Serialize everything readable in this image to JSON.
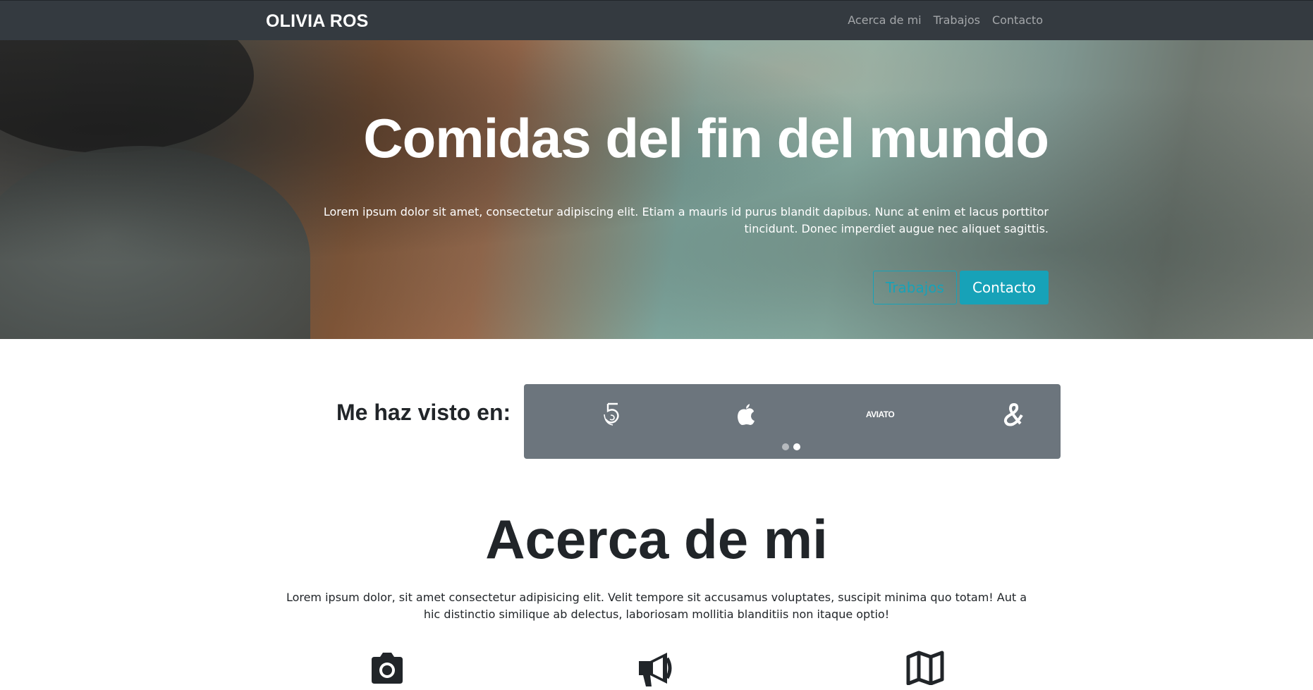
{
  "navbar": {
    "brand": "OLIVIA ROS",
    "links": [
      "Acerca de mi",
      "Trabajos",
      "Contacto"
    ]
  },
  "hero": {
    "title": "Comidas del fin del mundo",
    "lead": "Lorem ipsum dolor sit amet, consectetur adipiscing elit. Etiam a mauris id purus blandit dapibus. Nunc at enim et lacus porttitor tincidunt. Donec imperdiet augue nec aliquet sagittis.",
    "buttons": [
      "Trabajos",
      "Contacto"
    ]
  },
  "seen_on": {
    "label": "Me haz visto en:",
    "logos": [
      "five-logo-icon",
      "apple-logo-icon",
      "aviato-logo-icon",
      "ampersand-logo-icon"
    ],
    "aviato_text": "AVIATO",
    "carousel_slide": 2,
    "carousel_total": 2
  },
  "about": {
    "title": "Acerca de mi",
    "text": "Lorem ipsum dolor, sit amet consectetur adipisicing elit. Velit tempore sit accusamus voluptates, suscipit minima quo totam! Aut a hic distinctio similique ab delectus, laboriosam mollitia blanditiis non itaque optio!",
    "features": [
      "camera-icon",
      "megaphone-icon",
      "map-icon"
    ]
  },
  "colors": {
    "navbar_bg": "#343a40",
    "accent": "#17a2b8",
    "carousel_bg": "#6c757d",
    "text_dark": "#212529"
  }
}
